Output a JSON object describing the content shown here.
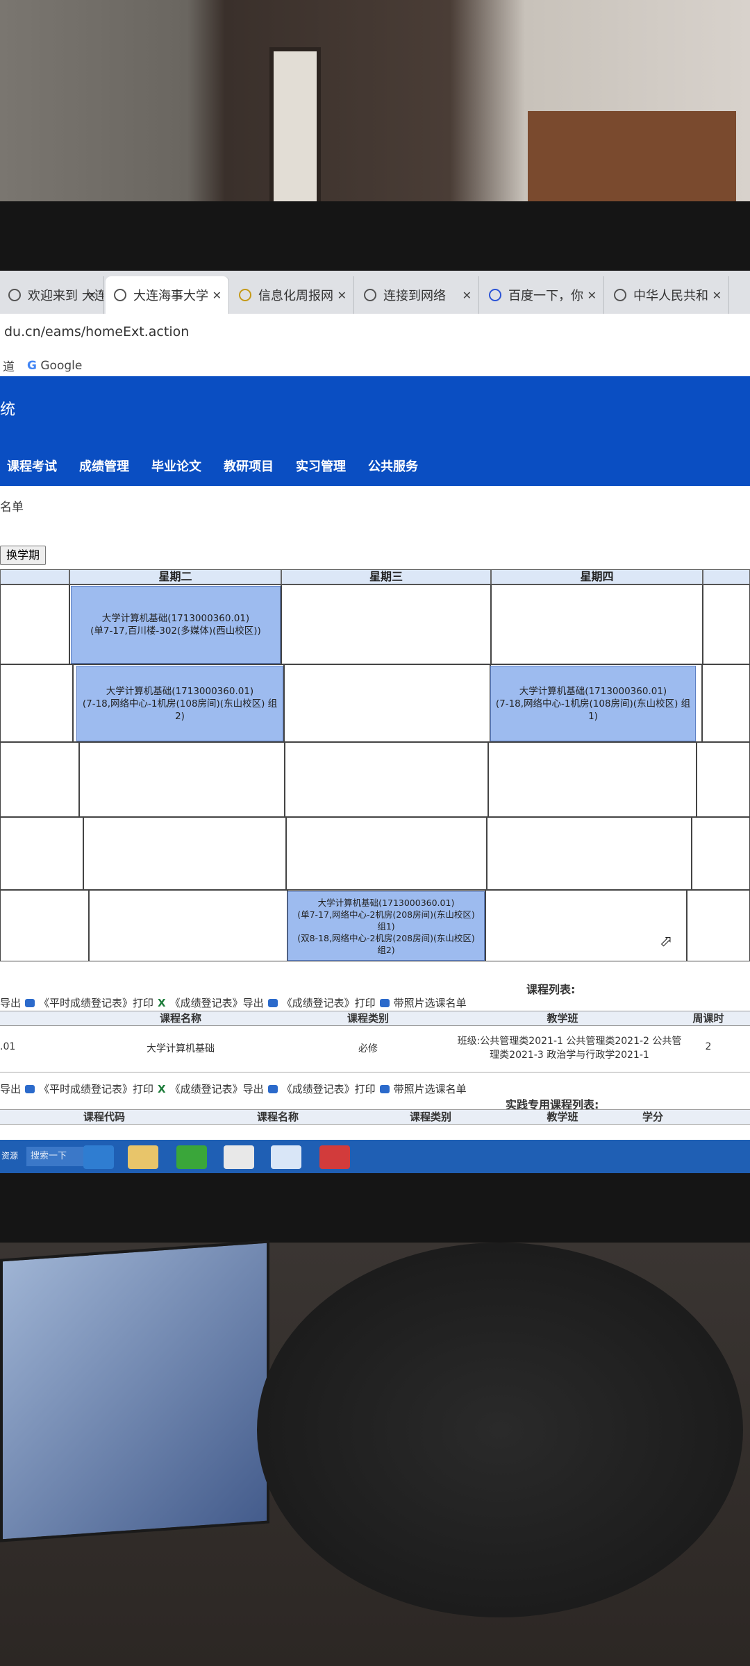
{
  "browser": {
    "tabs": [
      {
        "label": "欢迎来到 大连"
      },
      {
        "label": "大连海事大学"
      },
      {
        "label": "信息化周报网"
      },
      {
        "label": "连接到网络"
      },
      {
        "label": "百度一下，你"
      },
      {
        "label": "中华人民共和"
      }
    ],
    "address": "du.cn/eams/homeExt.action",
    "bookmarks": {
      "prefix": "道",
      "google_label": "Google",
      "google_letter": "G"
    }
  },
  "app": {
    "title": "统",
    "nav": [
      "课程考试",
      "成绩管理",
      "毕业论文",
      "教研项目",
      "实习管理",
      "公共服务"
    ],
    "breadcrumb": "名单",
    "term_button": "换学期"
  },
  "timetable": {
    "days": [
      "星期二",
      "星期三",
      "星期四"
    ],
    "courses": [
      {
        "day": "星期二",
        "lines": [
          "大学计算机基础(1713000360.01)",
          "(单7-17,百川楼-302(多媒体)(西山校区))"
        ]
      },
      {
        "day": "星期二",
        "lines": [
          "大学计算机基础(1713000360.01)",
          "(7-18,网络中心-1机房(108房间)(东山校区) 组",
          "2)"
        ]
      },
      {
        "day": "星期四",
        "lines": [
          "大学计算机基础(1713000360.01)",
          "(7-18,网络中心-1机房(108房间)(东山校区) 组",
          "1)"
        ]
      },
      {
        "day": "星期三",
        "lines": [
          "大学计算机基础(1713000360.01)",
          "(单7-17,网络中心-2机房(208房间)(东山校区)",
          "组1)",
          "(双8-18,网络中心-2机房(208房间)(东山校区)",
          "组2)"
        ]
      }
    ]
  },
  "tools": {
    "export": "导出",
    "print_regular": "《平时成绩登记表》打印",
    "export_grade": "《成绩登记表》导出",
    "print_grade": "《成绩登记表》打印",
    "photo_list": "带照片选课名单"
  },
  "course_list": {
    "caption": "课程列表:",
    "headers": [
      "课程名称",
      "课程类别",
      "教学班",
      "周课时"
    ],
    "row": {
      "code": ".01",
      "name": "大学计算机基础",
      "category": "必修",
      "class": "班级:公共管理类2021-1 公共管理类2021-2 公共管理类2021-3 政治学与行政学2021-1",
      "hours": "2"
    }
  },
  "practice_list": {
    "caption": "实践专用课程列表:",
    "headers": [
      "课程代码",
      "课程名称",
      "课程类别",
      "教学班",
      "学分"
    ]
  },
  "taskbar": {
    "search_placeholder": "搜索一下",
    "left_label": "资源"
  }
}
